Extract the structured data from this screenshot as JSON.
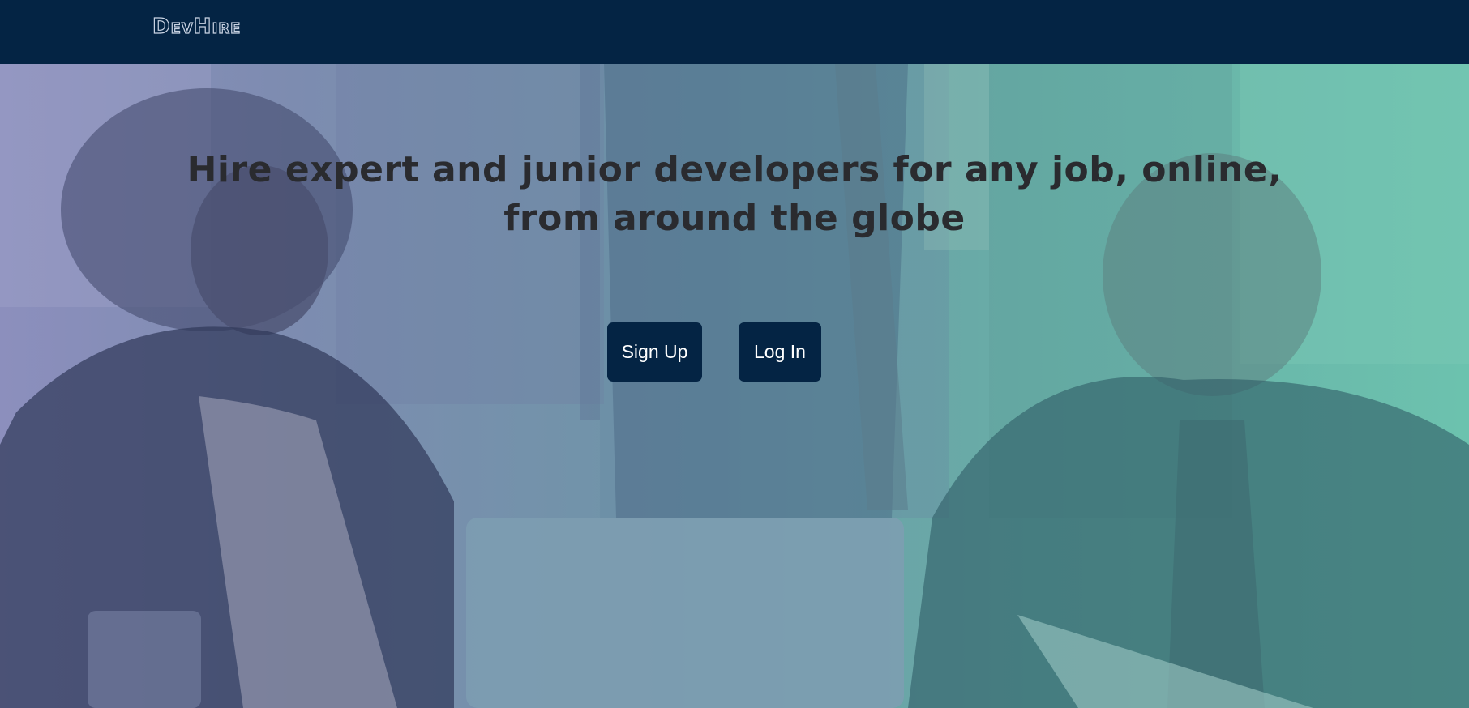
{
  "navbar": {
    "logo_text": "DevHire",
    "background": "#042444"
  },
  "hero": {
    "headline": "Hire expert and junior developers for any job, online, from around the globe",
    "background_image": "office-meeting-photo",
    "overlay_colors": [
      "#8c8fbd",
      "#6f95a8",
      "#6cc2ae"
    ]
  },
  "actions": {
    "signup_label": "Sign Up",
    "login_label": "Log In",
    "button_color": "#042444"
  }
}
